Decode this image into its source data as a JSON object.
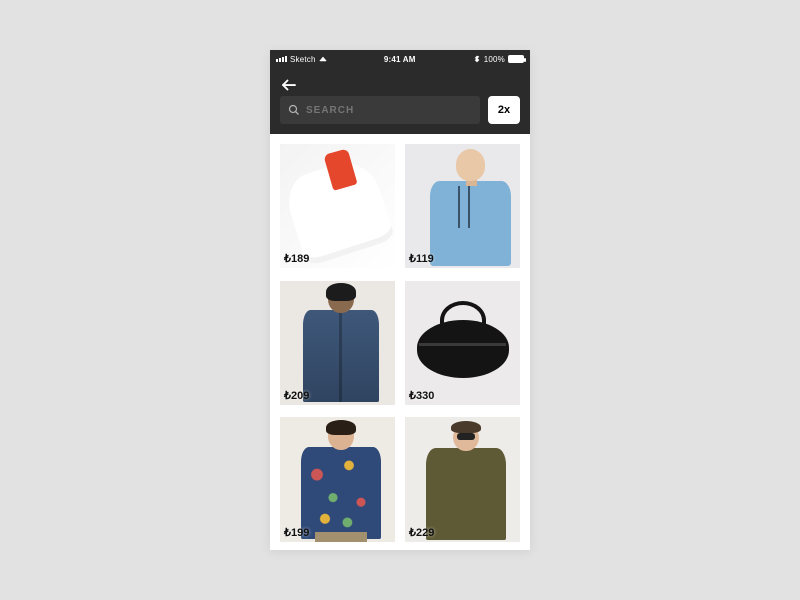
{
  "statusbar": {
    "carrier": "Sketch",
    "time": "9:41 AM",
    "battery_text": "100%"
  },
  "header": {
    "search_placeholder": "SEARCH",
    "grid_toggle_label": "2x"
  },
  "currency_symbol": "₺",
  "products": [
    {
      "price": "₺189"
    },
    {
      "price": "₺119"
    },
    {
      "price": "₺209"
    },
    {
      "price": "₺330"
    },
    {
      "price": "₺199"
    },
    {
      "price": "₺229"
    }
  ]
}
